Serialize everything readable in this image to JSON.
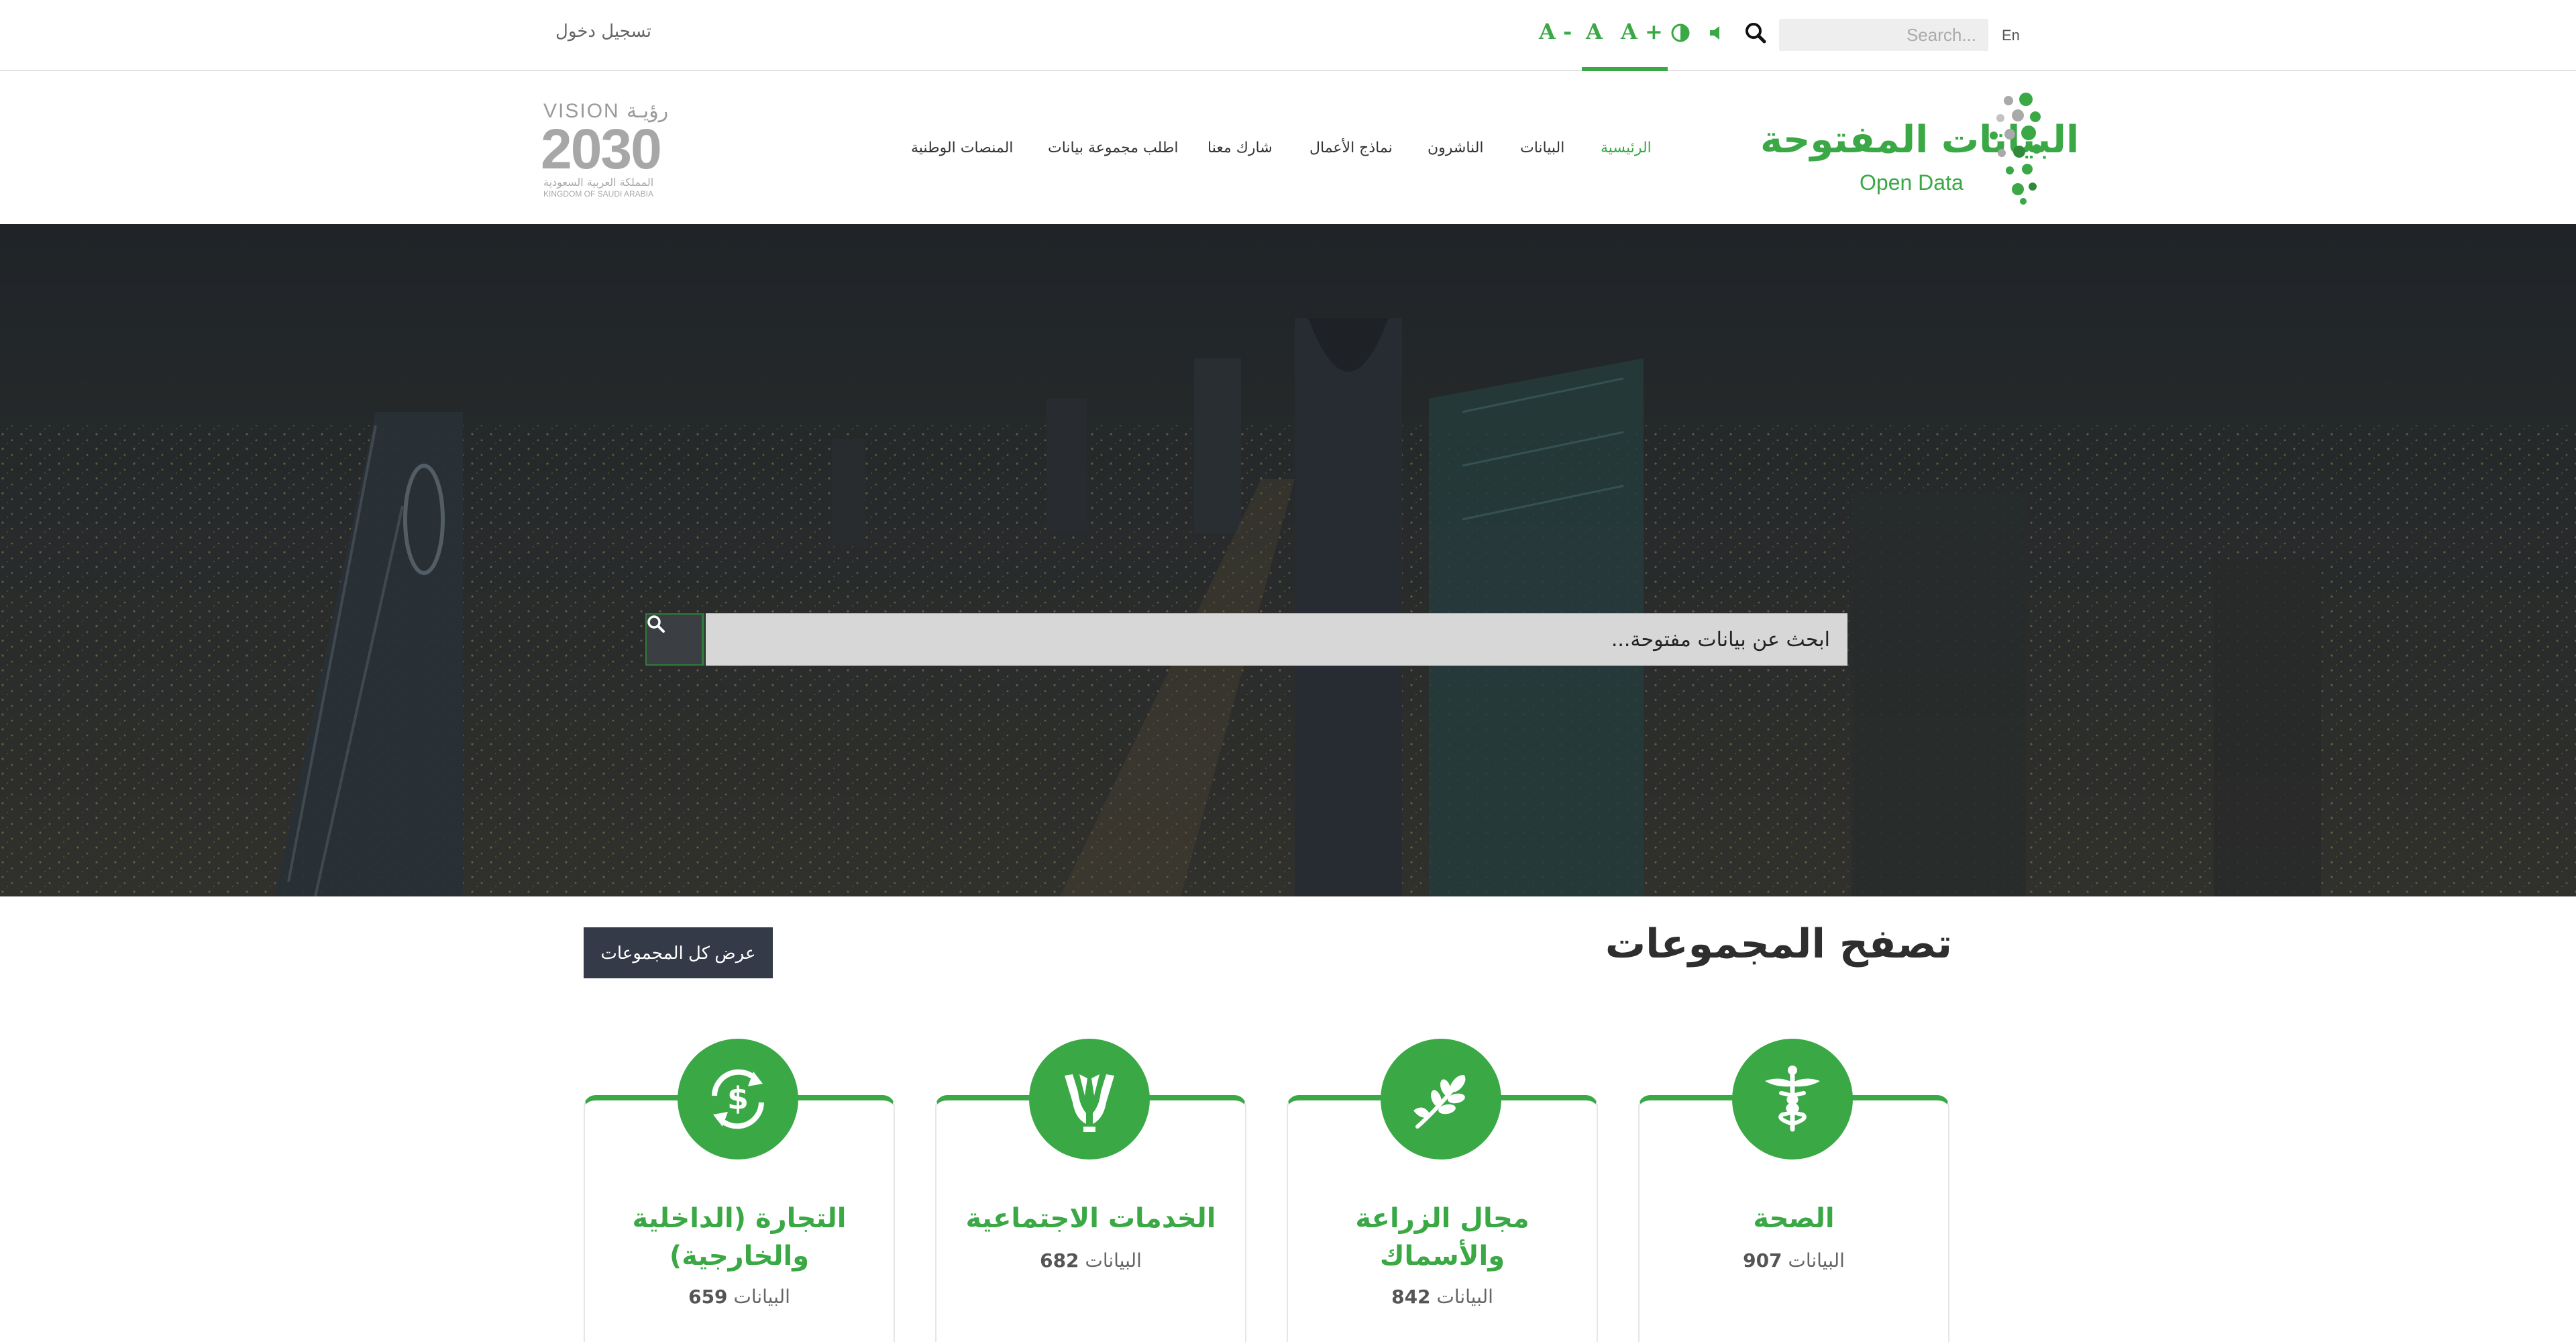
{
  "topbar": {
    "login": "تسجيل دخول",
    "lang": "En",
    "search_placeholder": "Search...",
    "font_decrease": "A -",
    "font_reset": "A",
    "font_increase": "A +"
  },
  "header": {
    "logo_ar": "البيانات المفتوحة",
    "logo_en": "Open Data",
    "vision": {
      "top": "VISION رؤيـة",
      "year": "2030",
      "ar": "المملكة العربية السعودية",
      "en": "KINGDOM OF SAUDI ARABIA"
    },
    "nav": [
      {
        "label": "الرئيسية",
        "active": true
      },
      {
        "label": "البيانات"
      },
      {
        "label": "الناشرون"
      },
      {
        "label": "نماذج الأعمال"
      },
      {
        "label": "شارك معنا"
      },
      {
        "label": "اطلب مجموعة بيانات"
      },
      {
        "label": "المنصات الوطنية"
      }
    ]
  },
  "hero": {
    "search_placeholder": "ابحث عن بيانات مفتوحة..."
  },
  "groups": {
    "title": "تصفح المجموعات",
    "view_all": "عرض كل المجموعات",
    "items": [
      {
        "title": "الصحة",
        "count_label": "البيانات",
        "count": "907",
        "icon": "caduceus-icon"
      },
      {
        "title": "مجال الزراعة والأسماك",
        "title_line1": "مجال الزراعة",
        "title_line2": "والأسماك",
        "count_label": "البيانات",
        "count": "842",
        "icon": "wheat-icon"
      },
      {
        "title": "الخدمات الاجتماعية",
        "count_label": "البيانات",
        "count": "682",
        "icon": "hands-icon"
      },
      {
        "title": "التجارة (الداخلية والخارجية)",
        "title_line1": "التجارة (الداخلية",
        "title_line2": "والخارجية)",
        "count_label": "البيانات",
        "count": "659",
        "icon": "currency-exchange-icon"
      }
    ]
  },
  "colors": {
    "accent": "#3aa845",
    "dark_button": "#343a48"
  }
}
